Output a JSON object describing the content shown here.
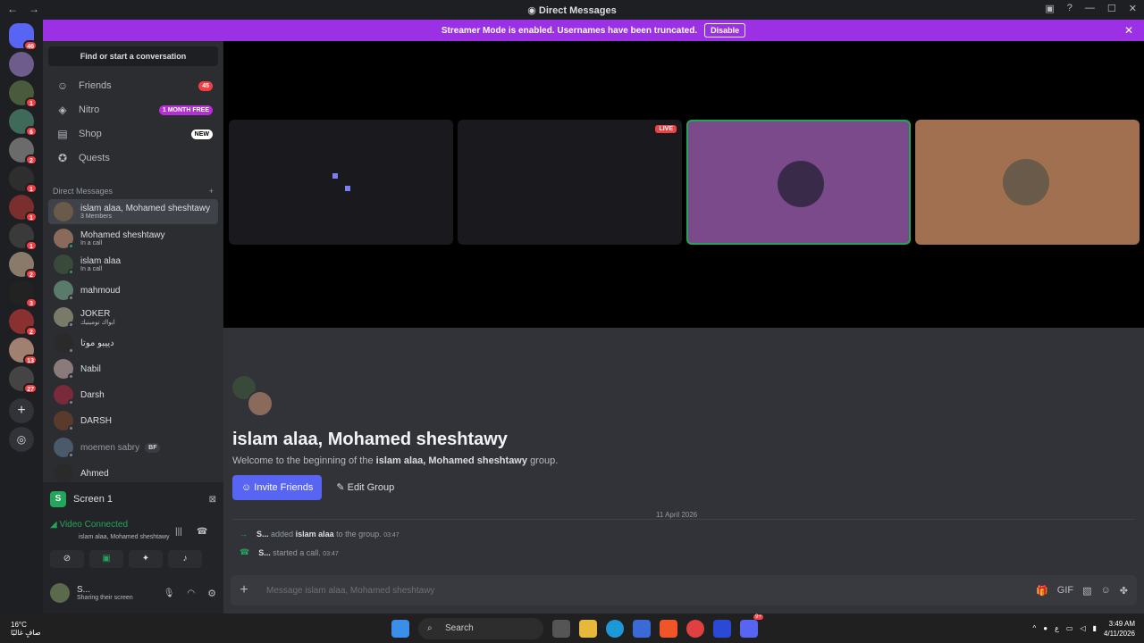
{
  "window": {
    "title": "Direct Messages"
  },
  "banner": {
    "text": "Streamer Mode is enabled. Usernames have been truncated.",
    "button": "Disable"
  },
  "sidebar": {
    "search_placeholder": "Find or start a conversation",
    "nav": [
      {
        "label": "Friends",
        "badge": "45",
        "icon": "friends-icon"
      },
      {
        "label": "Nitro",
        "badge": "1 MONTH FREE",
        "icon": "nitro-icon"
      },
      {
        "label": "Shop",
        "badge": "NEW",
        "icon": "shop-icon"
      },
      {
        "label": "Quests",
        "badge": "",
        "icon": "quests-icon"
      }
    ],
    "dm_header": "Direct Messages",
    "dms": [
      {
        "name": "islam alaa, Mohamed sheshtawy",
        "sub": "3 Members"
      },
      {
        "name": "Mohamed sheshtawy",
        "sub": "In a call"
      },
      {
        "name": "islam alaa",
        "sub": "In a call"
      },
      {
        "name": "mahmoud",
        "sub": ""
      },
      {
        "name": "JOKER",
        "sub": "ابواك تومينيك"
      },
      {
        "name": "دييبو موتا",
        "sub": ""
      },
      {
        "name": "Nabil",
        "sub": ""
      },
      {
        "name": "Darsh",
        "sub": ""
      },
      {
        "name": "DARSH",
        "sub": ""
      },
      {
        "name": "moemen sabry",
        "sub": "",
        "tag": "BF"
      },
      {
        "name": "Ahmed",
        "sub": ""
      }
    ]
  },
  "server_badges": [
    "46",
    "1",
    "6",
    "2",
    "1",
    "1",
    "1",
    "2",
    "3",
    "2",
    "13",
    "27"
  ],
  "voice": {
    "screen": "Screen 1",
    "status": "Video Connected",
    "channel": "islam alaa, Mohamed sheshtawy",
    "user": "S...",
    "user_status": "Sharing their screen"
  },
  "call": {
    "live_label": "LIVE"
  },
  "chat": {
    "group_title": "islam alaa, Mohamed sheshtawy",
    "welcome_prefix": "Welcome to the beginning of the",
    "welcome_group": "islam alaa, Mohamed sheshtawy",
    "welcome_suffix": "group.",
    "invite_button": "Invite Friends",
    "edit_button": "Edit Group",
    "date": "11 April 2026",
    "messages": [
      {
        "user": "S...",
        "text": "added",
        "target": "islam alaa",
        "rest": "to the group.",
        "time": "03:47"
      },
      {
        "user": "S...",
        "text": "started a call.",
        "target": "",
        "rest": "",
        "time": "03:47"
      }
    ],
    "composer_placeholder": "Message islam alaa, Mohamed sheshtawy"
  },
  "taskbar": {
    "weather_temp": "16°C",
    "weather_desc": "صافٍ غالبًا",
    "search": "Search",
    "lang": "ع",
    "time": "3:49 AM",
    "date": "4/11/2026",
    "discord_badge": "9+"
  },
  "colors": {
    "banner": "#9b30e5",
    "accent": "#5865f2",
    "online": "#23a55a",
    "live": "#ed4245"
  }
}
